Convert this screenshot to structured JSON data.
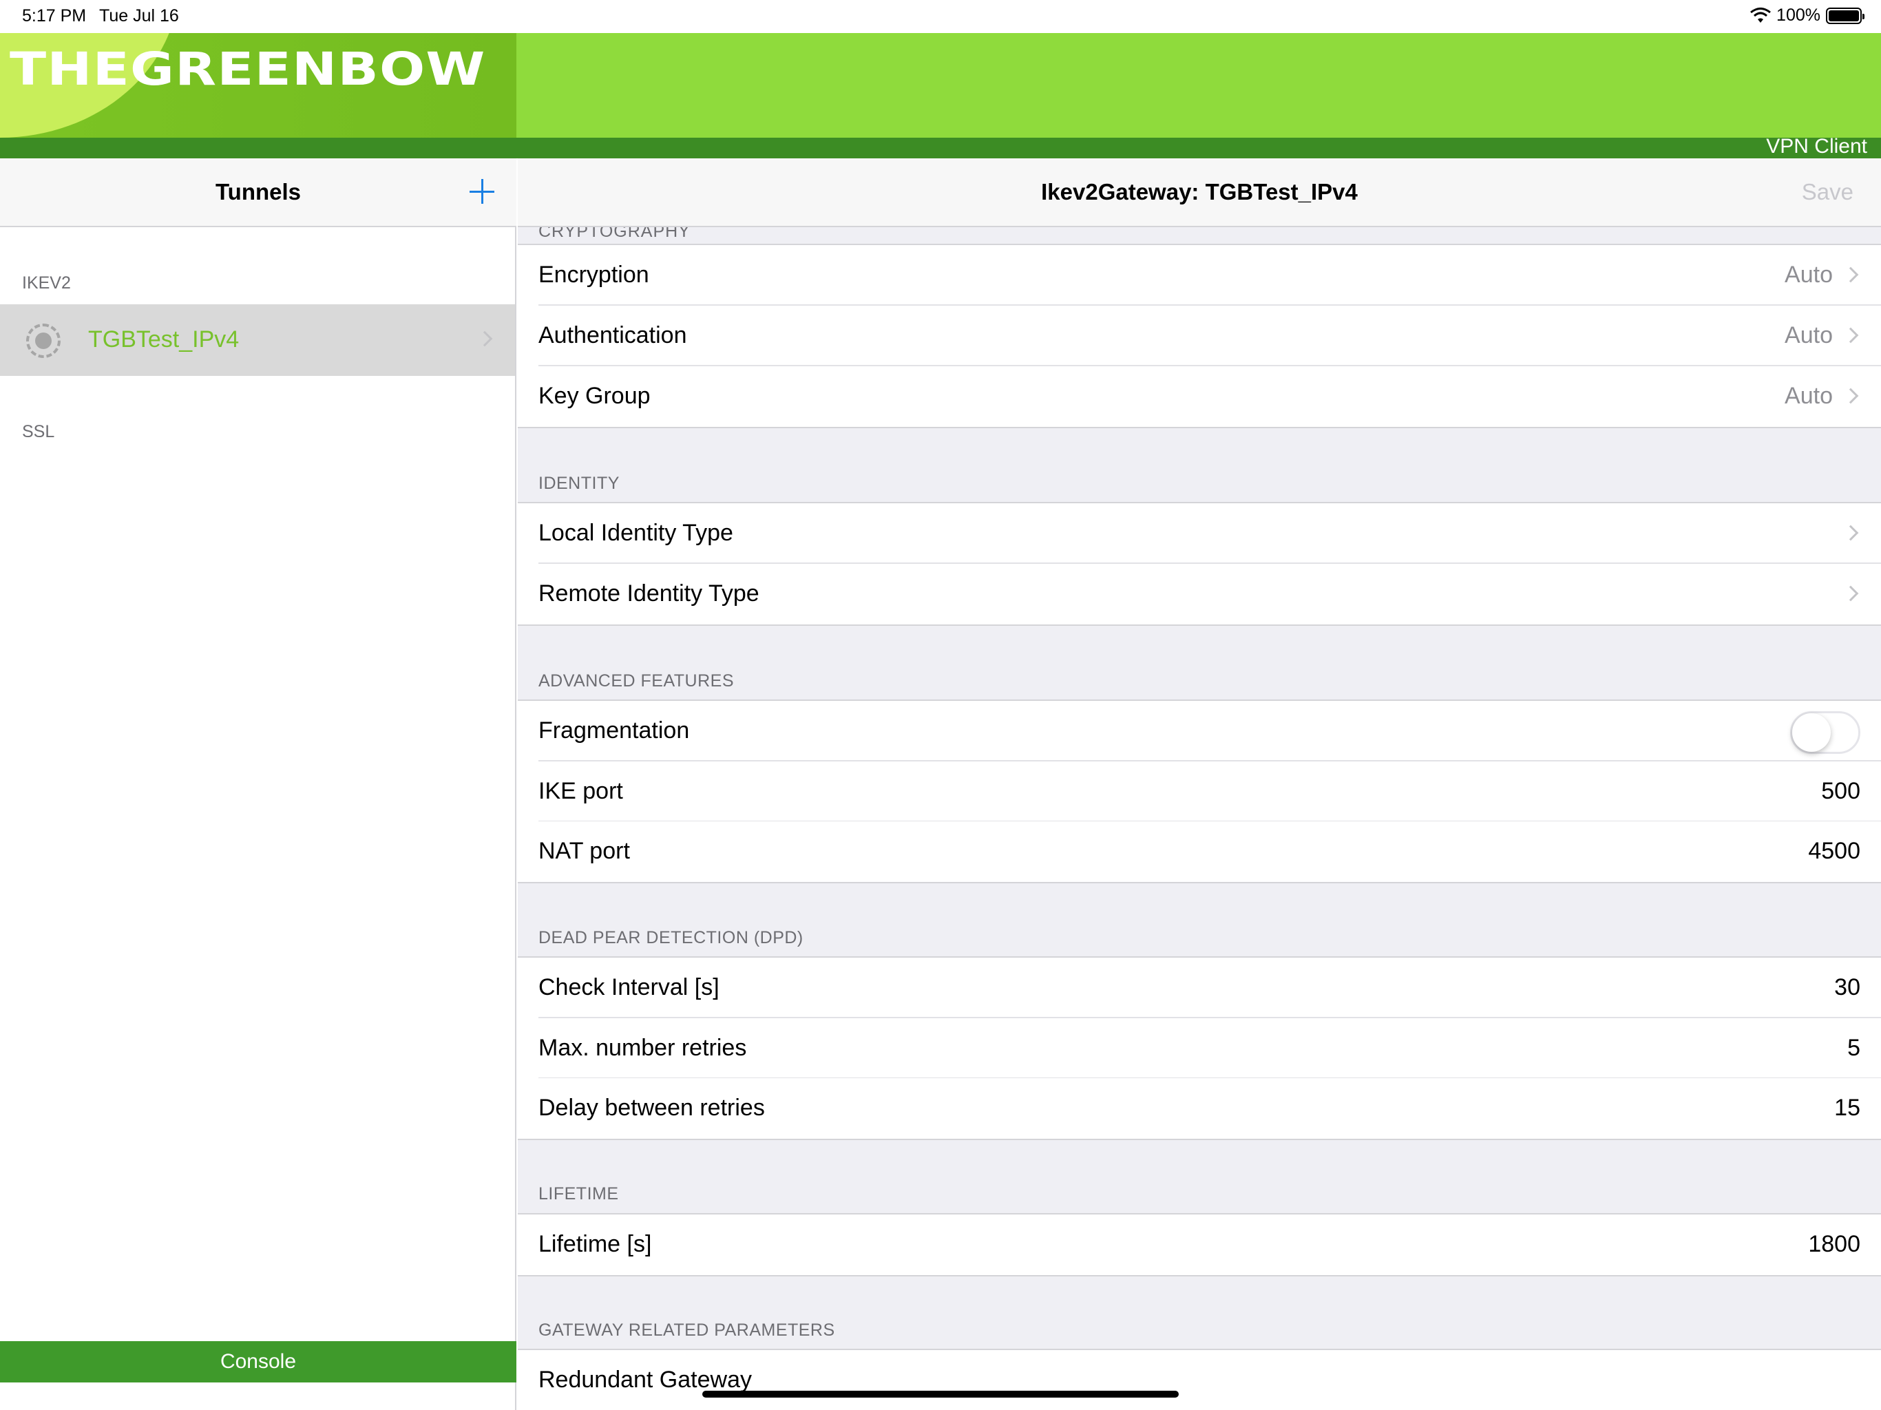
{
  "status_bar": {
    "time": "5:17 PM",
    "date": "Tue Jul 16",
    "battery": "100%",
    "wifi_icon": "wifi-icon",
    "battery_icon": "battery-icon"
  },
  "banner": {
    "logo": "THEGREENBOW",
    "product": "VPN Client",
    "colors": {
      "banner": "#8fdb3c",
      "strip": "#3c8c24",
      "accent_green": "#78c12c"
    }
  },
  "sidebar": {
    "title": "Tunnels",
    "add_icon": "plus-icon",
    "sections": [
      {
        "header": "IKEV2",
        "items": [
          {
            "label": "TGBTest_IPv4",
            "icon": "spinner-icon",
            "selected": true
          }
        ]
      },
      {
        "header": "SSL",
        "items": []
      }
    ],
    "console_label": "Console"
  },
  "detail": {
    "title": "Ikev2Gateway: TGBTest_IPv4",
    "save_label": "Save",
    "cut_header": "CRYPTOGRAPHY",
    "cryptography": [
      {
        "label": "Encryption",
        "value": "Auto"
      },
      {
        "label": "Authentication",
        "value": "Auto"
      },
      {
        "label": "Key Group",
        "value": "Auto"
      }
    ],
    "identity": {
      "header": "IDENTITY",
      "rows": [
        {
          "label": "Local Identity Type"
        },
        {
          "label": "Remote Identity Type"
        }
      ]
    },
    "advanced": {
      "header": "ADVANCED FEATURES",
      "fragmentation_label": "Fragmentation",
      "fragmentation_on": false,
      "ike_port_label": "IKE port",
      "ike_port": "500",
      "nat_port_label": "NAT port",
      "nat_port": "4500"
    },
    "dpd": {
      "header": "DEAD PEAR DETECTION (DPD)",
      "rows": [
        {
          "label": "Check Interval [s]",
          "value": "30"
        },
        {
          "label": "Max. number retries",
          "value": "5"
        },
        {
          "label": "Delay between retries",
          "value": "15"
        }
      ]
    },
    "lifetime": {
      "header": "LIFETIME",
      "label": "Lifetime [s]",
      "value": "1800"
    },
    "gateway": {
      "header": "GATEWAY RELATED PARAMETERS",
      "label": "Redundant Gateway"
    }
  }
}
